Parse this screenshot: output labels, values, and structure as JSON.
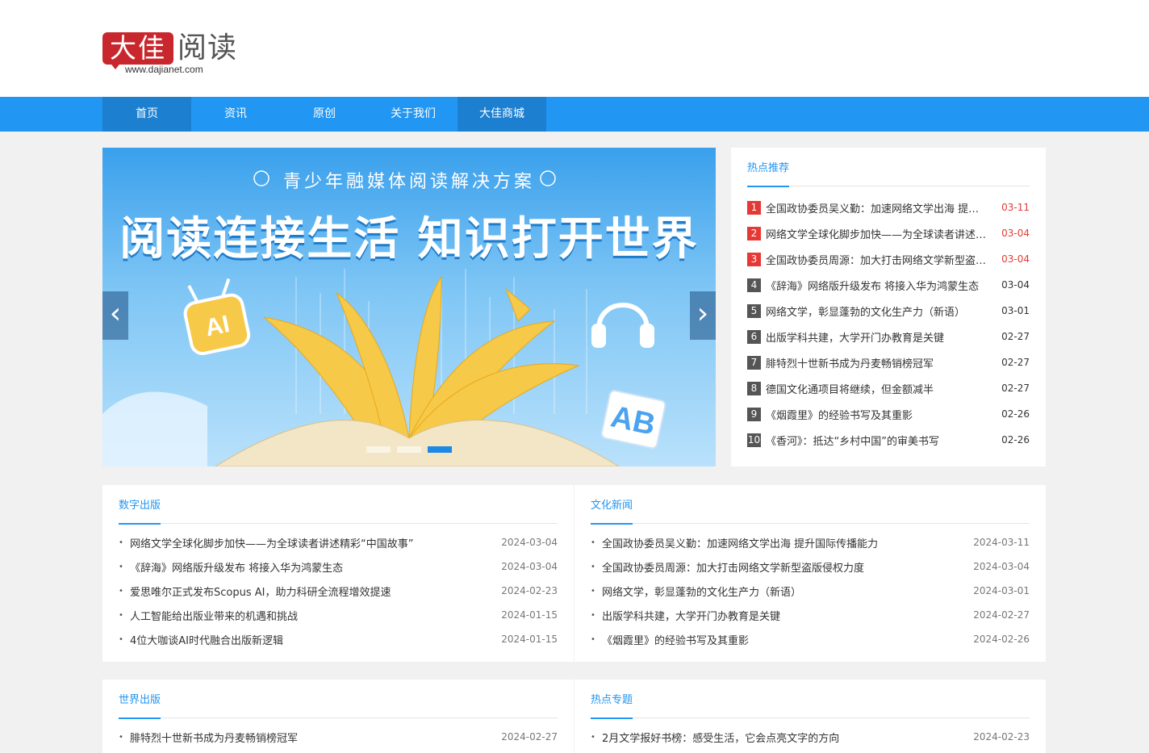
{
  "logo": {
    "mark": "大佳",
    "read": "阅读",
    "url": "www.dajianet.com"
  },
  "nav": [
    "首页",
    "资讯",
    "原创",
    "关于我们",
    "大佳商城"
  ],
  "banner": {
    "subtitle": "青少年融媒体阅读解决方案",
    "title": "阅读连接生活 知识打开世界",
    "ai_badge": "AI",
    "letters": "AB",
    "prev": "‹",
    "next": "›"
  },
  "hot": {
    "title": "热点推荐",
    "items": [
      {
        "rank": "1",
        "text": "全国政协委员吴义勤：加速网络文学出海 提升国际传播能力",
        "date": "03-11"
      },
      {
        "rank": "2",
        "text": "网络文学全球化脚步加快——为全球读者讲述精彩“中国故事”",
        "date": "03-04"
      },
      {
        "rank": "3",
        "text": "全国政协委员周源：加大打击网络文学新型盗版侵权力度",
        "date": "03-04"
      },
      {
        "rank": "4",
        "text": "《辞海》网络版升级发布 将接入华为鸿蒙生态",
        "date": "03-04"
      },
      {
        "rank": "5",
        "text": "网络文学，彰显蓬勃的文化生产力（新语）",
        "date": "03-01"
      },
      {
        "rank": "6",
        "text": "出版学科共建，大学开门办教育是关键",
        "date": "02-27"
      },
      {
        "rank": "7",
        "text": "腓特烈十世新书成为丹麦畅销榜冠军",
        "date": "02-27"
      },
      {
        "rank": "8",
        "text": "德国文化通项目将继续，但金额减半",
        "date": "02-27"
      },
      {
        "rank": "9",
        "text": "《烟霞里》的经验书写及其重影",
        "date": "02-26"
      },
      {
        "rank": "10",
        "text": "《香河》：抵达“乡村中国”的审美书写",
        "date": "02-26"
      }
    ]
  },
  "digital": {
    "title": "数字出版",
    "items": [
      {
        "text": "网络文学全球化脚步加快——为全球读者讲述精彩“中国故事”",
        "date": "2024-03-04"
      },
      {
        "text": "《辞海》网络版升级发布 将接入华为鸿蒙生态",
        "date": "2024-03-04"
      },
      {
        "text": "爱思唯尔正式发布Scopus AI，助力科研全流程增效提速",
        "date": "2024-02-23"
      },
      {
        "text": "人工智能给出版业带来的机遇和挑战",
        "date": "2024-01-15"
      },
      {
        "text": "4位大咖谈AI时代融合出版新逻辑",
        "date": "2024-01-15"
      }
    ]
  },
  "culture": {
    "title": "文化新闻",
    "items": [
      {
        "text": "全国政协委员吴义勤：加速网络文学出海 提升国际传播能力",
        "date": "2024-03-11"
      },
      {
        "text": "全国政协委员周源：加大打击网络文学新型盗版侵权力度",
        "date": "2024-03-04"
      },
      {
        "text": "网络文学，彰显蓬勃的文化生产力（新语）",
        "date": "2024-03-01"
      },
      {
        "text": "出版学科共建，大学开门办教育是关键",
        "date": "2024-02-27"
      },
      {
        "text": "《烟霞里》的经验书写及其重影",
        "date": "2024-02-26"
      }
    ]
  },
  "world": {
    "title": "世界出版",
    "items": [
      {
        "text": "腓特烈十世新书成为丹麦畅销榜冠军",
        "date": "2024-02-27"
      }
    ]
  },
  "topics": {
    "title": "热点专题",
    "items": [
      {
        "text": "2月文学报好书榜：感受生活，它会点亮文字的方向",
        "date": "2024-02-23"
      }
    ]
  },
  "colors": {
    "nav": "#2196f3",
    "nav_active": "#1c7fd0",
    "rank_top": "#e53935",
    "logo": "#c8282d"
  }
}
